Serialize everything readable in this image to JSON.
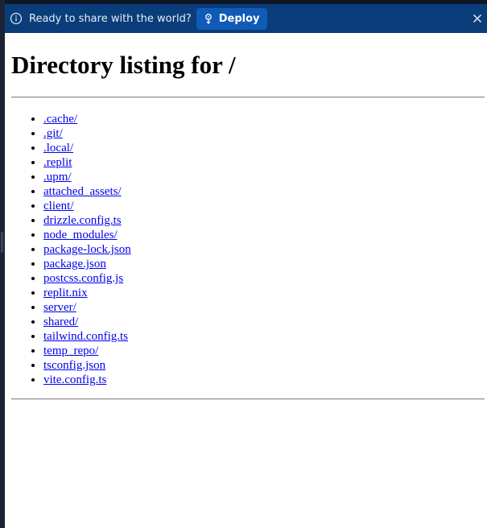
{
  "banner": {
    "message": "Ready to share with the world?",
    "deploy_label": "Deploy",
    "icons": [
      "info-icon",
      "deploy-icon",
      "close-icon"
    ]
  },
  "page": {
    "title": "Directory listing for /",
    "entries": [
      ".cache/",
      ".git/",
      ".local/",
      ".replit",
      ".upm/",
      "attached_assets/",
      "client/",
      "drizzle.config.ts",
      "node_modules/",
      "package-lock.json",
      "package.json",
      "postcss.config.js",
      "replit.nix",
      "server/",
      "shared/",
      "tailwind.config.ts",
      "temp_repo/",
      "tsconfig.json",
      "vite.config.ts"
    ]
  },
  "colors": {
    "banner_bg": "#0a3d7a",
    "deploy_bg": "#0f5bb5",
    "link": "#0000ee"
  }
}
